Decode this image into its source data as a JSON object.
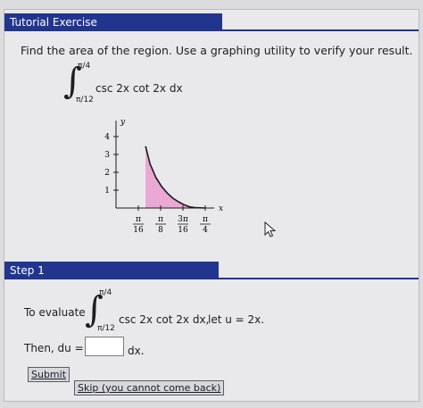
{
  "exercise": {
    "tab_label": "Tutorial Exercise",
    "prompt": "Find the area of the region. Use a graphing utility to verify your result.",
    "integral": {
      "upper": "π/4",
      "lower": "π/12",
      "integrand": "csc 2x cot 2x dx"
    }
  },
  "chart_data": {
    "type": "area",
    "xlabel": "x",
    "ylabel": "y",
    "x_ticks": [
      "π/16",
      "π/8",
      "3π/16",
      "π/4"
    ],
    "y_ticks": [
      "1",
      "2",
      "3",
      "4"
    ],
    "ylim": [
      0,
      4.5
    ],
    "curve": "y = csc 2x cot 2x",
    "shaded_interval": [
      "π/12",
      "π/4"
    ],
    "points": [
      {
        "x": 0.26,
        "y": 3.46
      },
      {
        "x": 0.3,
        "y": 2.46
      },
      {
        "x": 0.35,
        "y": 1.72
      },
      {
        "x": 0.4,
        "y": 1.22
      },
      {
        "x": 0.45,
        "y": 0.84
      },
      {
        "x": 0.5,
        "y": 0.55
      },
      {
        "x": 0.55,
        "y": 0.35
      },
      {
        "x": 0.6,
        "y": 0.18
      },
      {
        "x": 0.65,
        "y": 0.06
      },
      {
        "x": 0.7,
        "y": 0.02
      },
      {
        "x": 0.785,
        "y": 0.0
      }
    ],
    "colors": {
      "curve": "#1a1a1a",
      "fill": "#e9a9d4"
    }
  },
  "step": {
    "tab_label": "Step 1",
    "evaluate_prefix": "To evaluate",
    "integral": {
      "upper": "π/4",
      "lower": "π/12",
      "integrand": "csc 2x cot 2x dx,"
    },
    "let_text": "let  u = 2x.",
    "then_prefix": "Then,  du =",
    "answer_value": "",
    "dx_suffix": "dx."
  },
  "buttons": {
    "submit": "Submit",
    "skip": "Skip (you cannot come back)"
  },
  "colors": {
    "tab": "#22358e",
    "panel": "#e9e9ec",
    "button": "#d7d7dc"
  }
}
